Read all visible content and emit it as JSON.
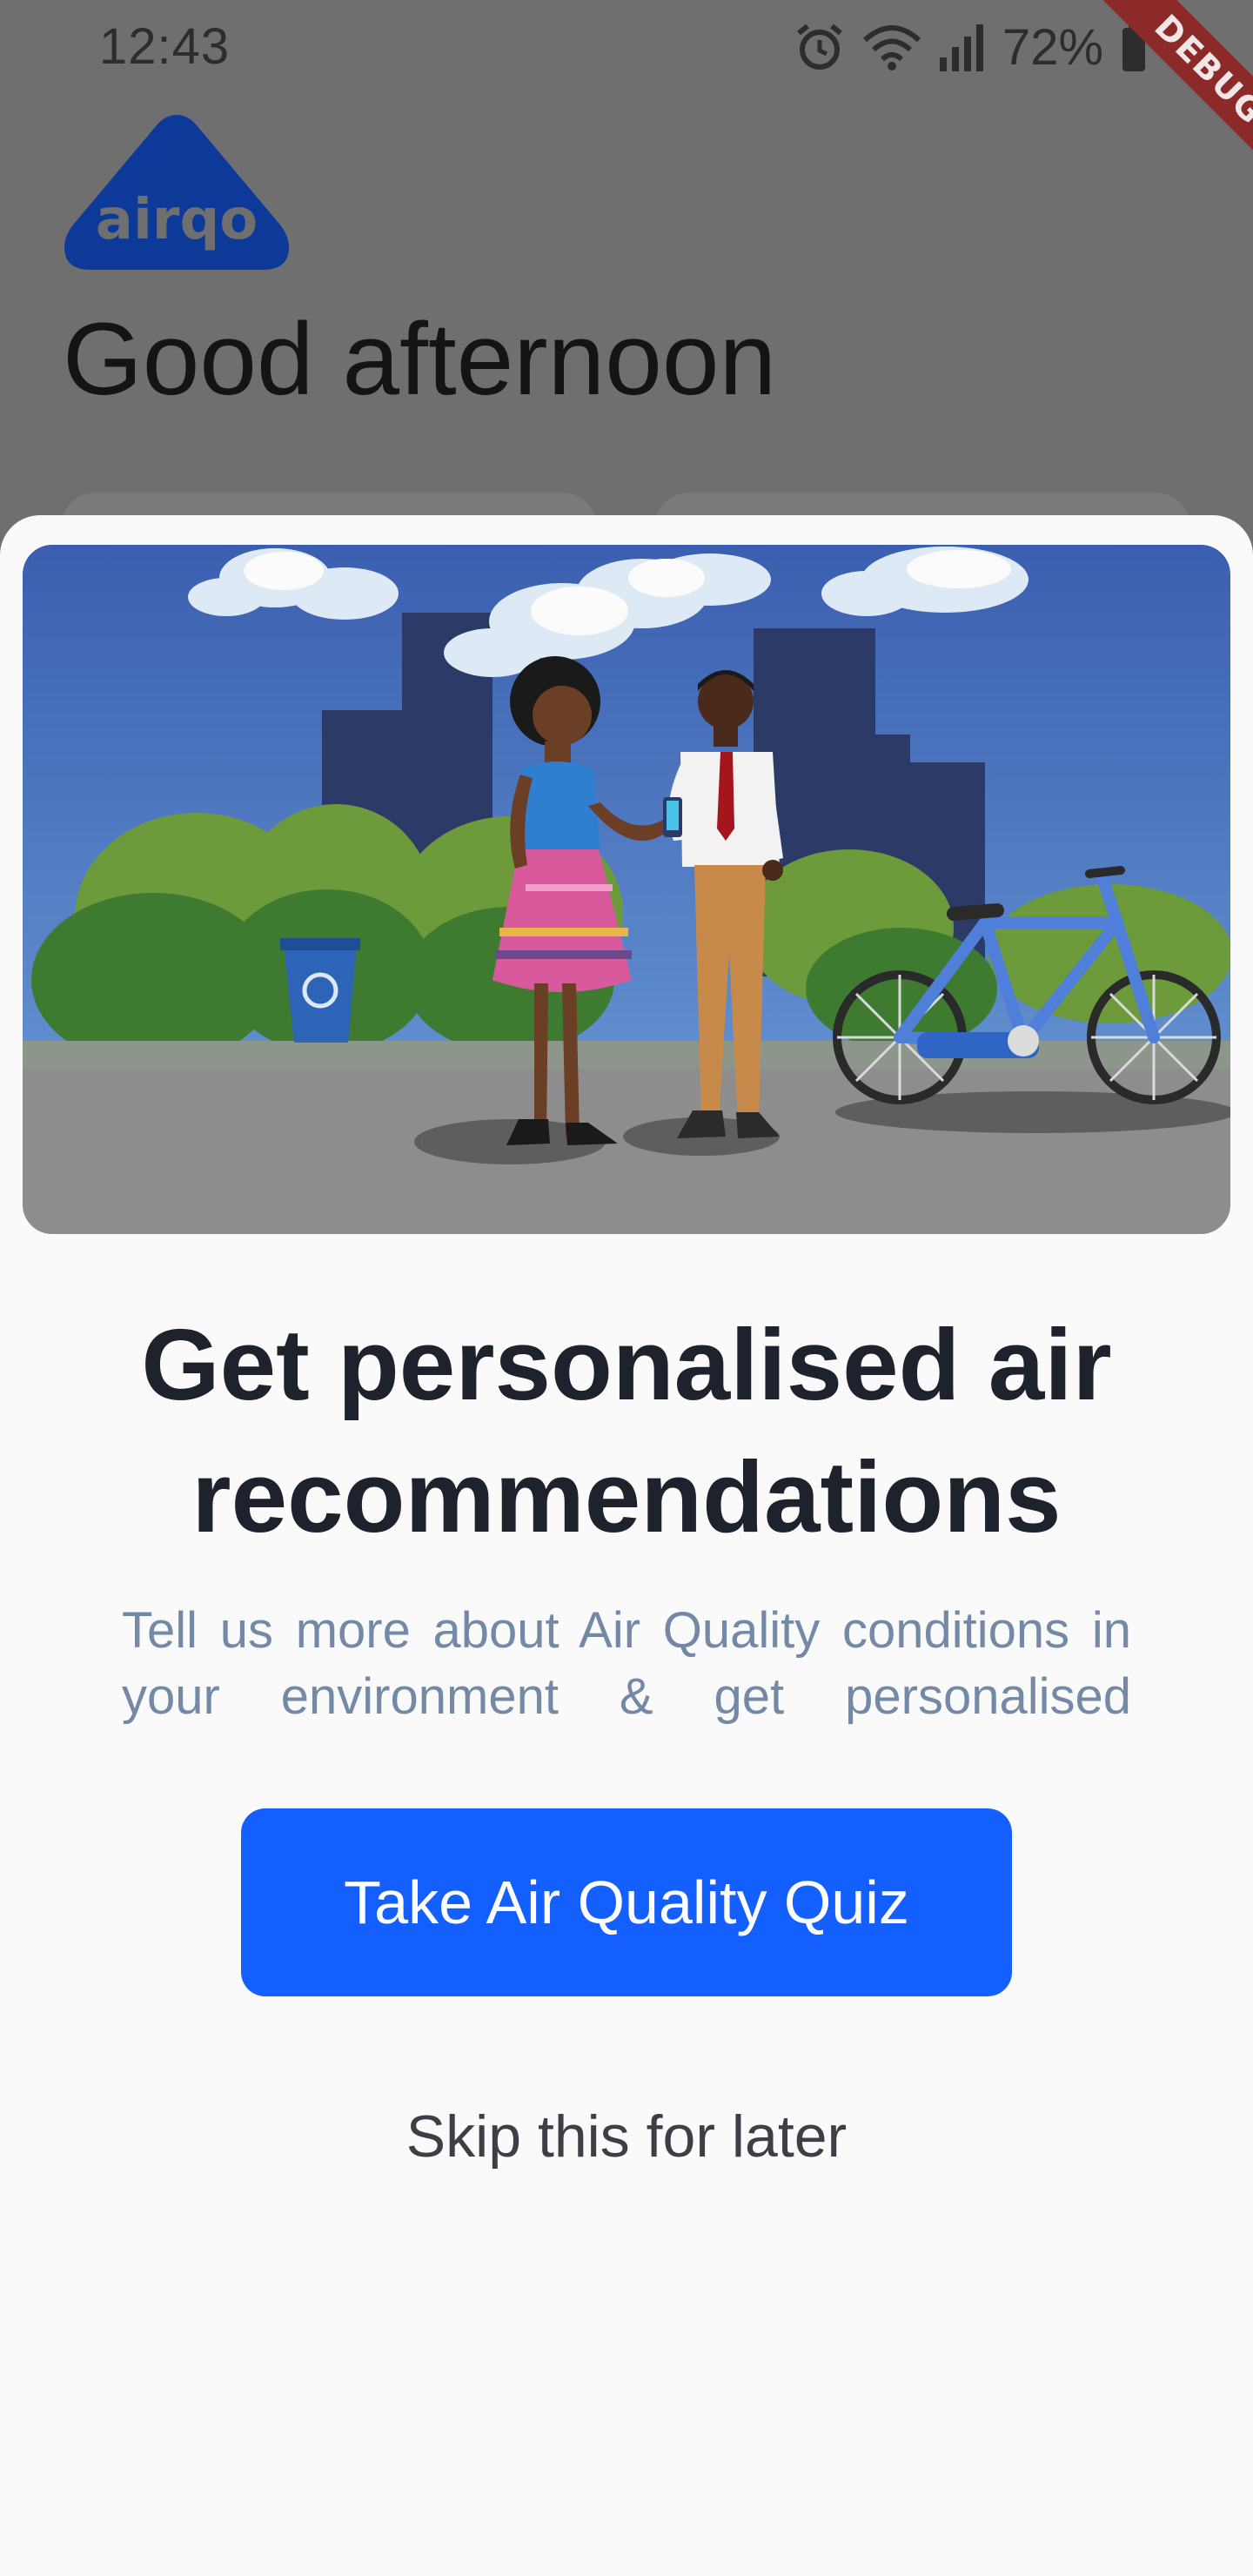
{
  "status_bar": {
    "time": "12:43",
    "battery": "72%",
    "icons": [
      "alarm-icon",
      "wifi-icon",
      "signal-icon",
      "battery-charging-icon"
    ]
  },
  "debug_banner": {
    "label": "DEBUG"
  },
  "header": {
    "logo_text": "airqo",
    "greeting": "Good afternoon"
  },
  "sheet": {
    "title": "Get personalised air recommendations",
    "subtitle": "Tell us more about Air Quality conditions in your environment & get personalised",
    "primary_button": "Take Air Quality Quiz",
    "secondary_link": "Skip this for later"
  },
  "colors": {
    "accent": "#145fff",
    "logo": "#0d3a99",
    "title": "#1e222c",
    "subtitle": "#7489a6",
    "scrim": "#6f6f6f"
  }
}
